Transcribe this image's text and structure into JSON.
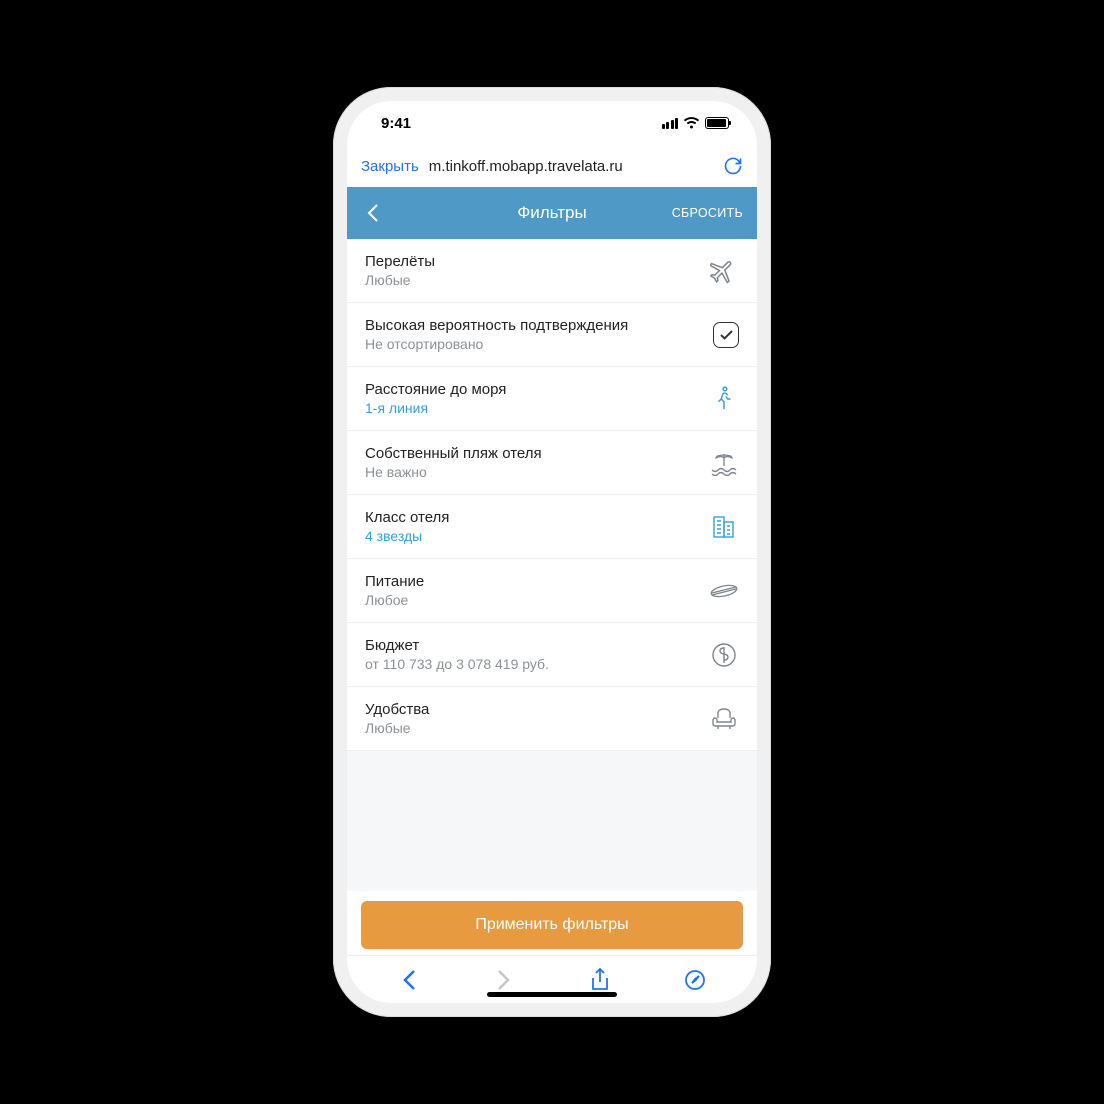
{
  "statusbar": {
    "time": "9:41"
  },
  "addressbar": {
    "close": "Закрыть",
    "url": "m.tinkoff.mobapp.travelata.ru"
  },
  "header": {
    "title": "Фильтры",
    "reset": "СБРОСИТЬ"
  },
  "filters": [
    {
      "title": "Перелёты",
      "sub": "Любые",
      "active": false,
      "icon": "airplane"
    },
    {
      "title": "Высокая вероятность подтверждения",
      "sub": "Не отсортировано",
      "active": false,
      "icon": "checkbox"
    },
    {
      "title": "Расстояние до моря",
      "sub": "1-я линия",
      "active": true,
      "icon": "walk"
    },
    {
      "title": "Собственный пляж отеля",
      "sub": "Не важно",
      "active": false,
      "icon": "beach"
    },
    {
      "title": "Класс отеля",
      "sub": "4 звезды",
      "active": true,
      "icon": "building"
    },
    {
      "title": "Питание",
      "sub": "Любое",
      "active": false,
      "icon": "food"
    },
    {
      "title": "Бюджет",
      "sub": "от 110 733 до 3 078 419 руб.",
      "active": false,
      "icon": "coin"
    },
    {
      "title": "Удобства",
      "sub": "Любые",
      "active": false,
      "icon": "armchair"
    }
  ],
  "apply": "Применить фильтры"
}
